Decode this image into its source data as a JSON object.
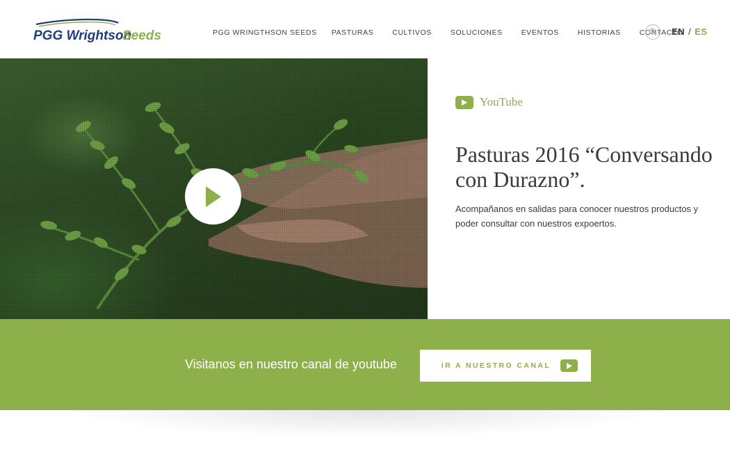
{
  "brand": {
    "logo_text_a": "PGG Wrightson",
    "logo_text_b": "Seeds",
    "colors": {
      "blue": "#1f3d7a",
      "green": "#8db04b"
    }
  },
  "nav": {
    "items": [
      "PGG WRINGTHSON SEEDS",
      "PASTURAS",
      "CULTIVOS",
      "SOLUCIONES",
      "EVENTOS",
      "HISTORIAS",
      "CONTACTO"
    ],
    "search_icon": "search-icon",
    "lang_en": "EN",
    "lang_sep": "/",
    "lang_es": "ES"
  },
  "video": {
    "play_icon": "play-icon"
  },
  "content": {
    "source_label": "YouTube",
    "title": "Pasturas 2016 “Conversando con Durazno”.",
    "description": "Acompañanos en salidas para conocer nuestros productos y poder consultar con nuestros expoertos."
  },
  "cta": {
    "text": "Visitanos en nuestro canal de youtube",
    "button_label": "IR A NUESTRO CANAL",
    "button_icon": "youtube-icon"
  }
}
